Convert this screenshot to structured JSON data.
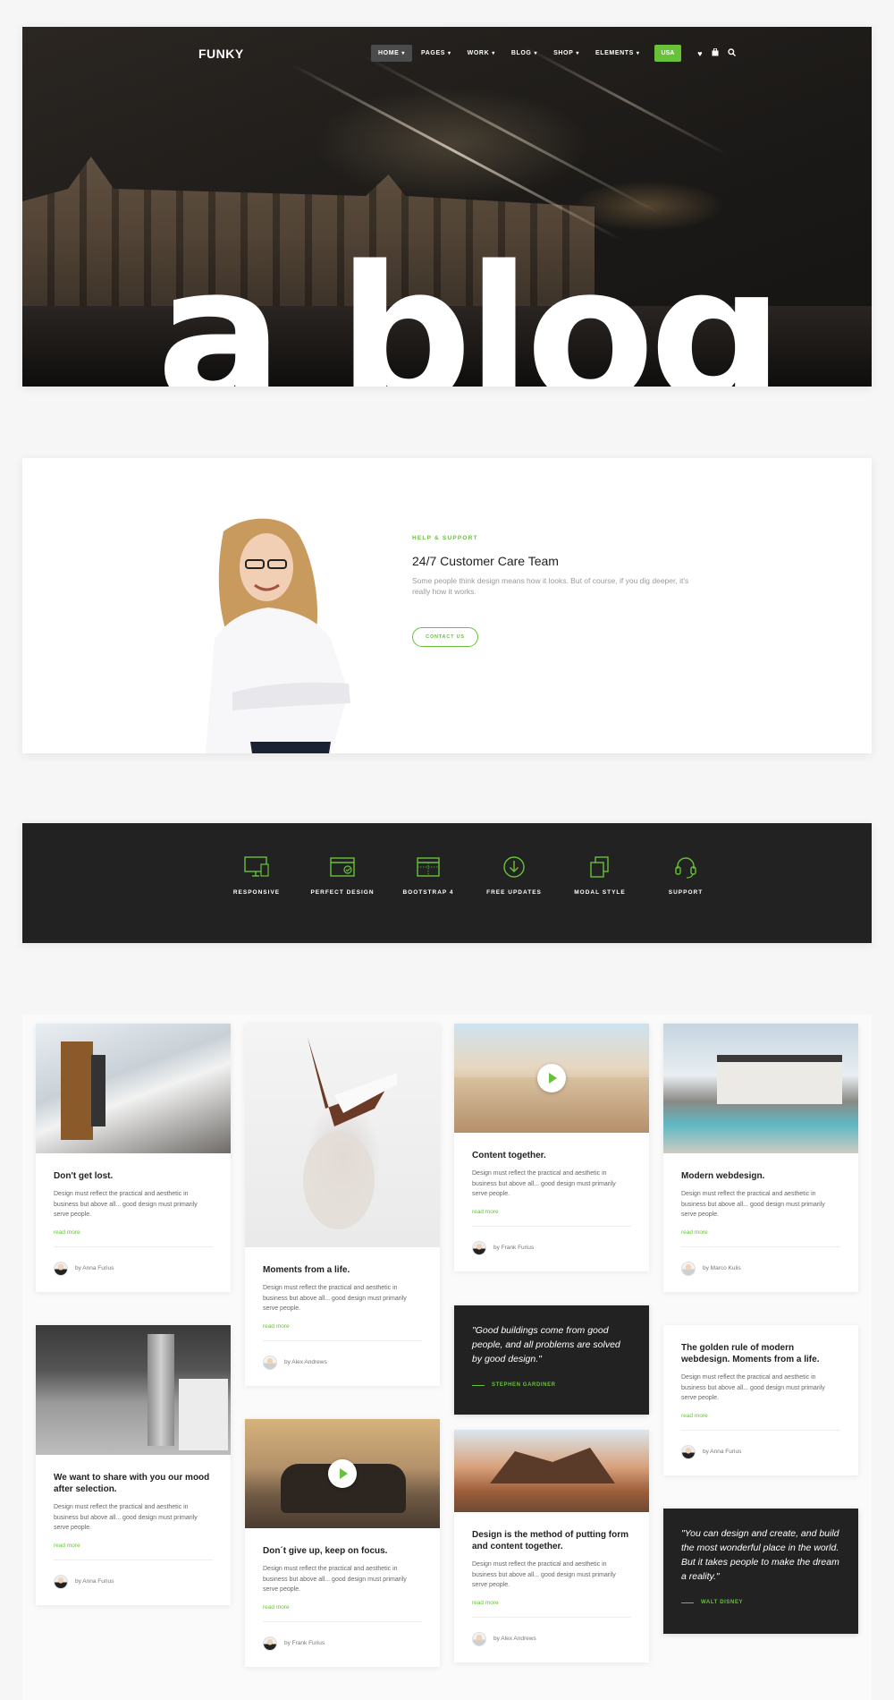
{
  "nav": {
    "logo": "FUNKY",
    "items": [
      {
        "label": "HOME",
        "active": true
      },
      {
        "label": "PAGES"
      },
      {
        "label": "WORK"
      },
      {
        "label": "BLOG"
      },
      {
        "label": "SHOP"
      },
      {
        "label": "ELEMENTS"
      }
    ],
    "cta": "USA",
    "icons": [
      "heart-icon",
      "bag-icon",
      "search-icon"
    ]
  },
  "hero": {
    "headline": "a blog"
  },
  "support": {
    "eyebrow": "HELP & SUPPORT",
    "title": "24/7 Customer Care Team",
    "text": "Some people think design means how it looks. But of course, if you dig deeper, it's really how it works.",
    "button": "CONTACT US"
  },
  "features": [
    {
      "label": "RESPONSIVE",
      "icon": "monitor-icon"
    },
    {
      "label": "PERFECT DESIGN",
      "icon": "browser-check-icon"
    },
    {
      "label": "BOOTSTRAP 4",
      "icon": "grid-window-icon"
    },
    {
      "label": "FREE UPDATES",
      "icon": "download-circle-icon"
    },
    {
      "label": "MODAL STYLE",
      "icon": "layers-icon"
    },
    {
      "label": "SUPPORT",
      "icon": "headset-icon"
    }
  ],
  "colors": {
    "accent": "#67c23a",
    "dark": "#222222"
  },
  "blog": {
    "read_more": "read more",
    "excerpt": "Design must reflect the practical and aesthetic in business but above all... good design must primarily serve people.",
    "posts": [
      {
        "title": "Don't get lost.",
        "author": "by Anna Furius"
      },
      {
        "title": "We want to share with you our mood after selection.",
        "author": "by Anna Furius"
      },
      {
        "title": "Moments from a life.",
        "author": "by Alex Andrews"
      },
      {
        "title": "Don´t give up, keep on focus.",
        "author": "by Frank Furius"
      },
      {
        "title": "Content together.",
        "author": "by Frank Furius"
      },
      {
        "title": "Design is the method of putting form and content together.",
        "author": "by Alex Andrews"
      },
      {
        "title": "Modern webdesign.",
        "author": "by Marco Kulis"
      },
      {
        "title": "The golden rule of modern webdesign. Moments from a life.",
        "author": "by Anna Furius"
      }
    ],
    "quotes": [
      {
        "text": "\"Good buildings come from good people, and all problems are solved by good design.\"",
        "author": "STEPHEN GARDINER"
      },
      {
        "text": "\"You can design and create, and build the most wonderful place in the world. But it takes people to make the dream a reality.\"",
        "author": "WALT DISNEY"
      }
    ]
  }
}
